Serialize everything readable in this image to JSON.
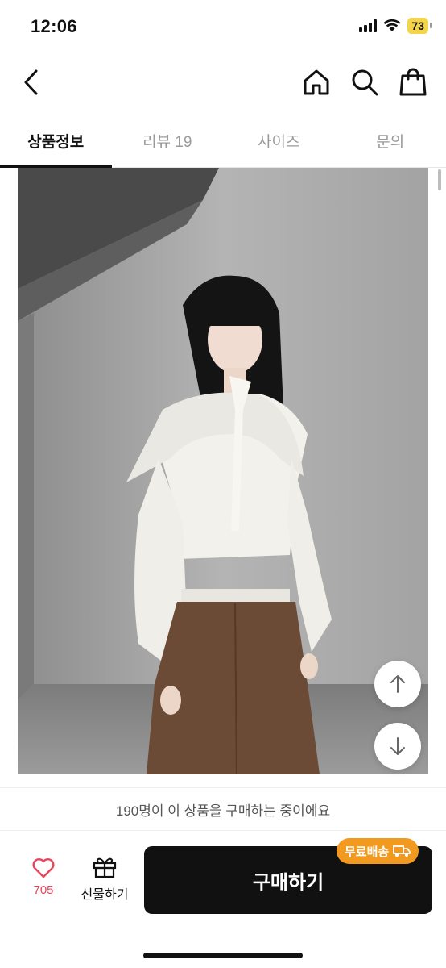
{
  "status_bar": {
    "time": "12:06",
    "battery": "73"
  },
  "tabs": [
    {
      "label": "상품정보",
      "active": true
    },
    {
      "label": "리뷰 19",
      "active": false
    },
    {
      "label": "사이즈",
      "active": false
    },
    {
      "label": "문의",
      "active": false
    }
  ],
  "viewer_notice": "190명이 이 상품을 구매하는 중이에요",
  "bottom_bar": {
    "like_count": "705",
    "gift_label": "선물하기",
    "buy_label": "구매하기",
    "shipping_badge": "무료배송"
  },
  "colors": {
    "accent_like": "#e8455b",
    "badge": "#f29a1f",
    "buy_button": "#111111"
  }
}
